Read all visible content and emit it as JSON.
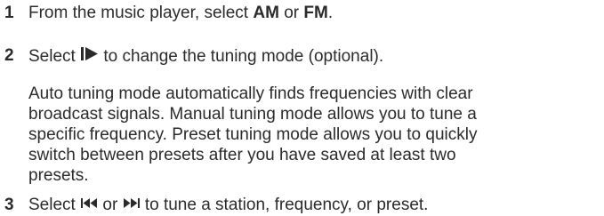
{
  "heading_partial": "",
  "steps": [
    {
      "number": "1",
      "text_before": "From the music player, select ",
      "option_am": "AM",
      "connector": " or ",
      "option_fm": "FM",
      "text_after": "."
    },
    {
      "number": "2",
      "text_before": "Select ",
      "icon": "play-mode-icon",
      "text_after": " to change the tuning mode (optional)."
    },
    {
      "number": "3",
      "text_before": "Select ",
      "icon_prev": "previous-track-icon",
      "connector": " or ",
      "icon_next": "next-track-icon",
      "text_after": " to tune a station, frequency, or preset."
    }
  ],
  "note_lines": [
    "Auto tuning mode automatically finds frequencies with clear",
    "broadcast signals. Manual tuning mode allows you to tune a",
    "specific frequency. Preset tuning mode allows you to quickly",
    "switch between presets after you have saved at least two",
    "presets."
  ],
  "colors": {
    "text": "#2b2b2b",
    "background": "#ffffff"
  }
}
